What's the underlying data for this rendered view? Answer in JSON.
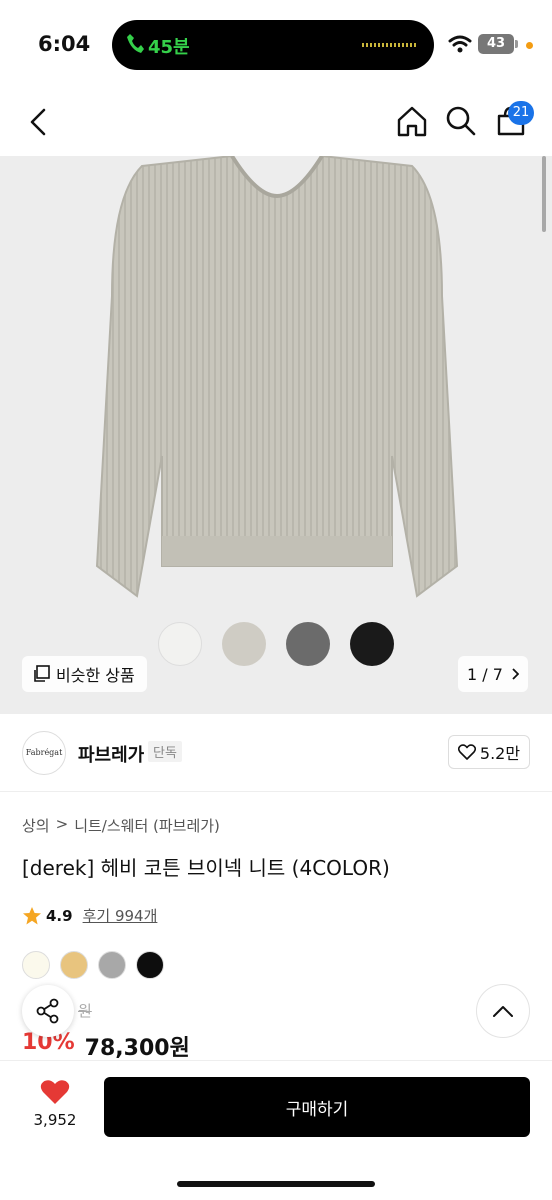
{
  "status_bar": {
    "time": "6:04",
    "call_text": "45분",
    "battery": "43"
  },
  "header": {
    "cart_count": "21"
  },
  "gallery": {
    "similar_label": "비슷한 상품",
    "page_indicator": "1 / 7",
    "thumb_colors": [
      "#f2f2f0",
      "#cfccc4",
      "#6b6b6b",
      "#1a1a1a"
    ]
  },
  "brand": {
    "logo_text": "Fabrégat",
    "name": "파브레가",
    "tag": "단독",
    "likes": "5.2만"
  },
  "product": {
    "breadcrumb": [
      "상의",
      ">",
      "니트/스웨터 (파브레가)"
    ],
    "title": "[derek] 헤비 코튼 브이넥 니트 (4COLOR)",
    "rating": "4.9",
    "reviews": "후기 994개",
    "color_swatches": [
      "#fbf9ec",
      "#e8c47e",
      "#a8a8a8",
      "#0d0d0d"
    ],
    "original_price_partial": "원",
    "discount": "10%",
    "price": "78,300원"
  },
  "bottom_bar": {
    "wishlist_count": "3,952",
    "buy_label": "구매하기"
  },
  "colors": {
    "accent_blue": "#1a73e8",
    "sale_red": "#e53935",
    "call_green": "#35d04a"
  }
}
